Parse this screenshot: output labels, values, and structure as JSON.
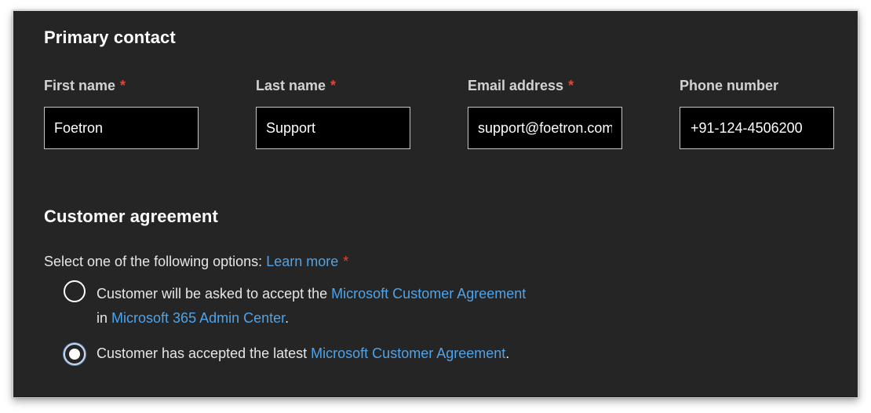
{
  "primary_contact": {
    "title": "Primary contact",
    "fields": [
      {
        "label": "First name",
        "required": "*",
        "value": "Foetron"
      },
      {
        "label": "Last name",
        "required": "*",
        "value": "Support"
      },
      {
        "label": "Email address",
        "required": "*",
        "value": "support@foetron.com"
      },
      {
        "label": "Phone number",
        "required": "",
        "value": "+91-124-4506200"
      }
    ]
  },
  "customer_agreement": {
    "title": "Customer agreement",
    "instruction": "Select one of the following options:",
    "learn_more": "Learn more",
    "required": "*",
    "options": [
      {
        "text_before": "Customer will be asked to accept the",
        "link1": "Microsoft Customer Agreement",
        "text_mid": "in",
        "link2": "Microsoft 365 Admin Center",
        "text_after": ".",
        "selected": false
      },
      {
        "text_before": "Customer has accepted the latest",
        "link1": "Microsoft Customer Agreement",
        "text_after": ".",
        "selected": true
      }
    ]
  }
}
